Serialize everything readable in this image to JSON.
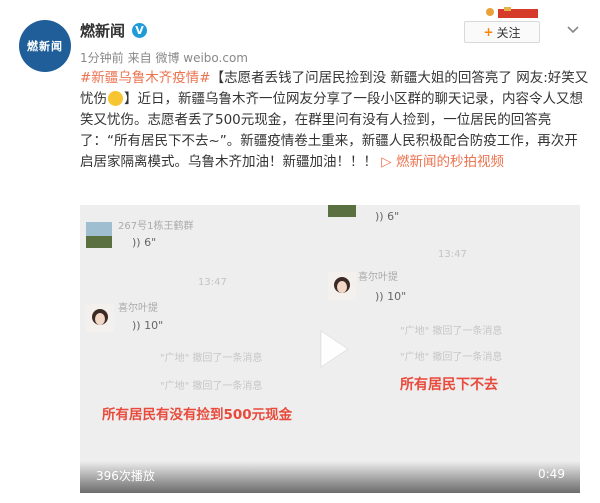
{
  "header": {
    "avatar_text": "燃新闻",
    "author": "燃新闻",
    "verified_icon": "verified-v-icon",
    "time": "1分钟前",
    "source": "来自 微博 weibo.com",
    "follow_label": "关注",
    "follow_icon": "plus-icon",
    "menu_icon": "chevron-down-icon"
  },
  "post": {
    "hashtag": "#新疆乌鲁木齐疫情#",
    "text_part1": "【志愿者丢钱了问居民捡到没 新疆大姐的回答亮了 网友:好笑又忧伤",
    "text_part2": "】近日，新疆乌鲁木齐一位网友分享了一段小区群的聊天记录，内容令人又想笑又忧伤。志愿者丢了500元现金，在群里问有没有人捡到，一位居民的回答亮了：“所有居民下不去~”。新疆疫情卷土重来，新疆人民积极配合防疫工作，再次开启居家隔离模式。乌鲁木齐加油！新疆加油！！！",
    "video_link_icon": "video-link-icon",
    "video_link_text": "燃新闻的秒拍视频"
  },
  "video": {
    "group_name": "267号1栋王鹤群",
    "voice1": "6\"",
    "voice2": "6\"",
    "time1": "13:47",
    "sender1": "喜尔叶提",
    "voice3": "10\"",
    "time2": "13:47",
    "sender2": "喜尔叶提",
    "voice4": "10\"",
    "recall1": "\"广地\" 撤回了一条消息",
    "recall2": "\"广地\" 撤回了一条消息",
    "recall3": "\"广地\" 撤回了一条消息",
    "recall4": "\"广地\" 撤回了一条消息",
    "caption_left": "所有居民有没有捡到500元现金",
    "caption_right": "所有居民下不去",
    "views": "396次播放",
    "duration": "0:49",
    "play_icon": "play-icon"
  }
}
